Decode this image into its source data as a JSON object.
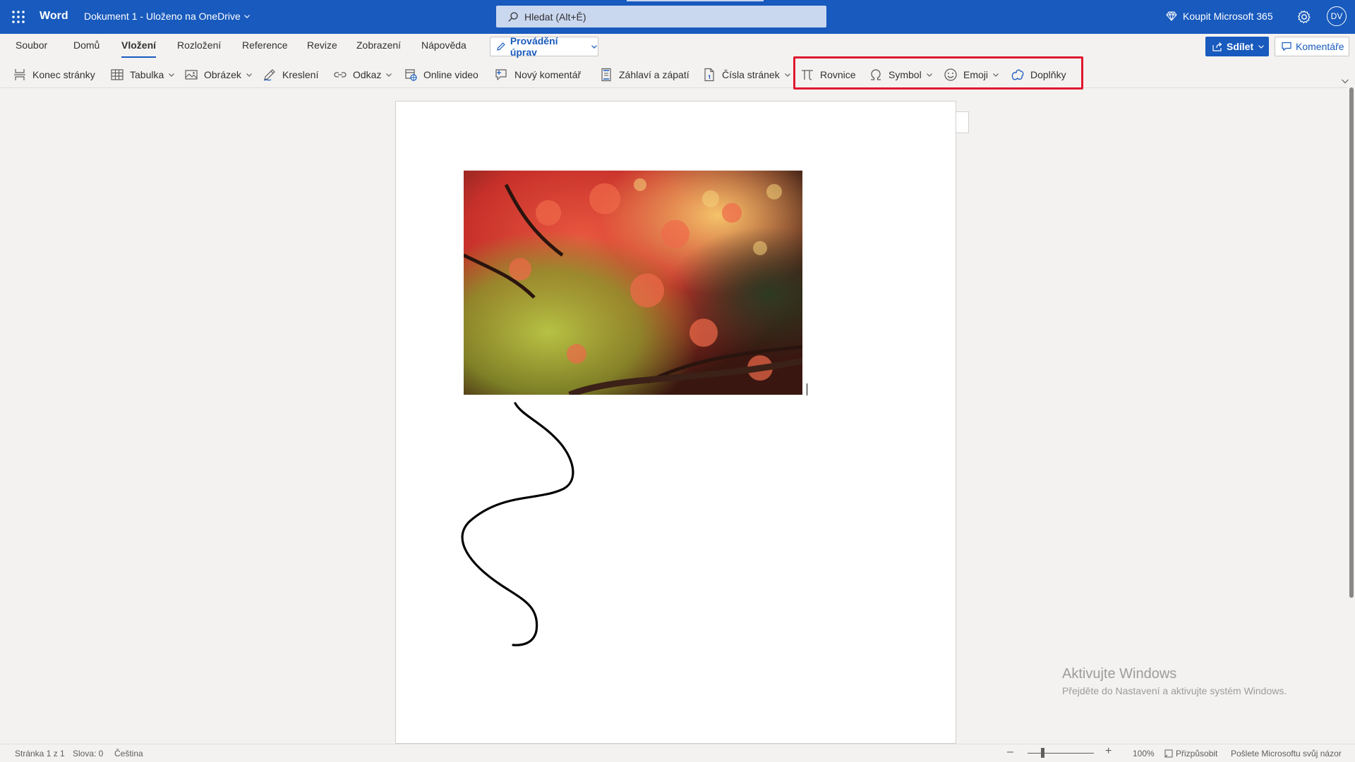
{
  "titlebar": {
    "app_name": "Word",
    "doc_title": "Dokument 1  -  Uloženo na OneDrive",
    "search_placeholder": "Hledat (Alt+Ě)",
    "buy_label": "Koupit Microsoft 365",
    "avatar_initials": "DV"
  },
  "tabs": [
    {
      "label": "Soubor",
      "active": false
    },
    {
      "label": "Domů",
      "active": false
    },
    {
      "label": "Vložení",
      "active": true
    },
    {
      "label": "Rozložení",
      "active": false
    },
    {
      "label": "Reference",
      "active": false
    },
    {
      "label": "Revize",
      "active": false
    },
    {
      "label": "Zobrazení",
      "active": false
    },
    {
      "label": "Nápověda",
      "active": false
    }
  ],
  "edit_mode_label": "Provádění úprav",
  "share_label": "Sdílet",
  "comments_label": "Komentáře",
  "tools": [
    {
      "label": "Konec stránky",
      "icon": "page-break-icon",
      "dropdown": false
    },
    {
      "label": "Tabulka",
      "icon": "table-icon",
      "dropdown": true
    },
    {
      "label": "Obrázek",
      "icon": "picture-icon",
      "dropdown": true
    },
    {
      "label": "Kreslení",
      "icon": "drawing-icon",
      "dropdown": false
    },
    {
      "label": "Odkaz",
      "icon": "link-icon",
      "dropdown": true
    },
    {
      "label": "Online video",
      "icon": "online-video-icon",
      "dropdown": false
    },
    {
      "label": "Nový komentář",
      "icon": "new-comment-icon",
      "dropdown": false
    },
    {
      "label": "Záhlaví a zápatí",
      "icon": "header-footer-icon",
      "dropdown": false
    },
    {
      "label": "Čísla stránek",
      "icon": "page-numbers-icon",
      "dropdown": true
    },
    {
      "label": "Rovnice",
      "icon": "equation-icon",
      "dropdown": false
    },
    {
      "label": "Symbol",
      "icon": "omega-icon",
      "dropdown": true
    },
    {
      "label": "Emoji",
      "icon": "emoji-icon",
      "dropdown": true
    },
    {
      "label": "Doplňky",
      "icon": "addins-icon",
      "dropdown": false
    }
  ],
  "highlight_color": "#e0182f",
  "accent_color": "#185abd",
  "watermark": {
    "line1": "Aktivujte Windows",
    "line2": "Přejděte do Nastavení a aktivujte systém Windows."
  },
  "statusbar": {
    "page": "Stránka 1 z 1",
    "words": "Slova: 0",
    "language": "Čeština",
    "zoom": "100%",
    "fit": "Přizpůsobit",
    "feedback": "Pošlete Microsoftu svůj názor"
  }
}
